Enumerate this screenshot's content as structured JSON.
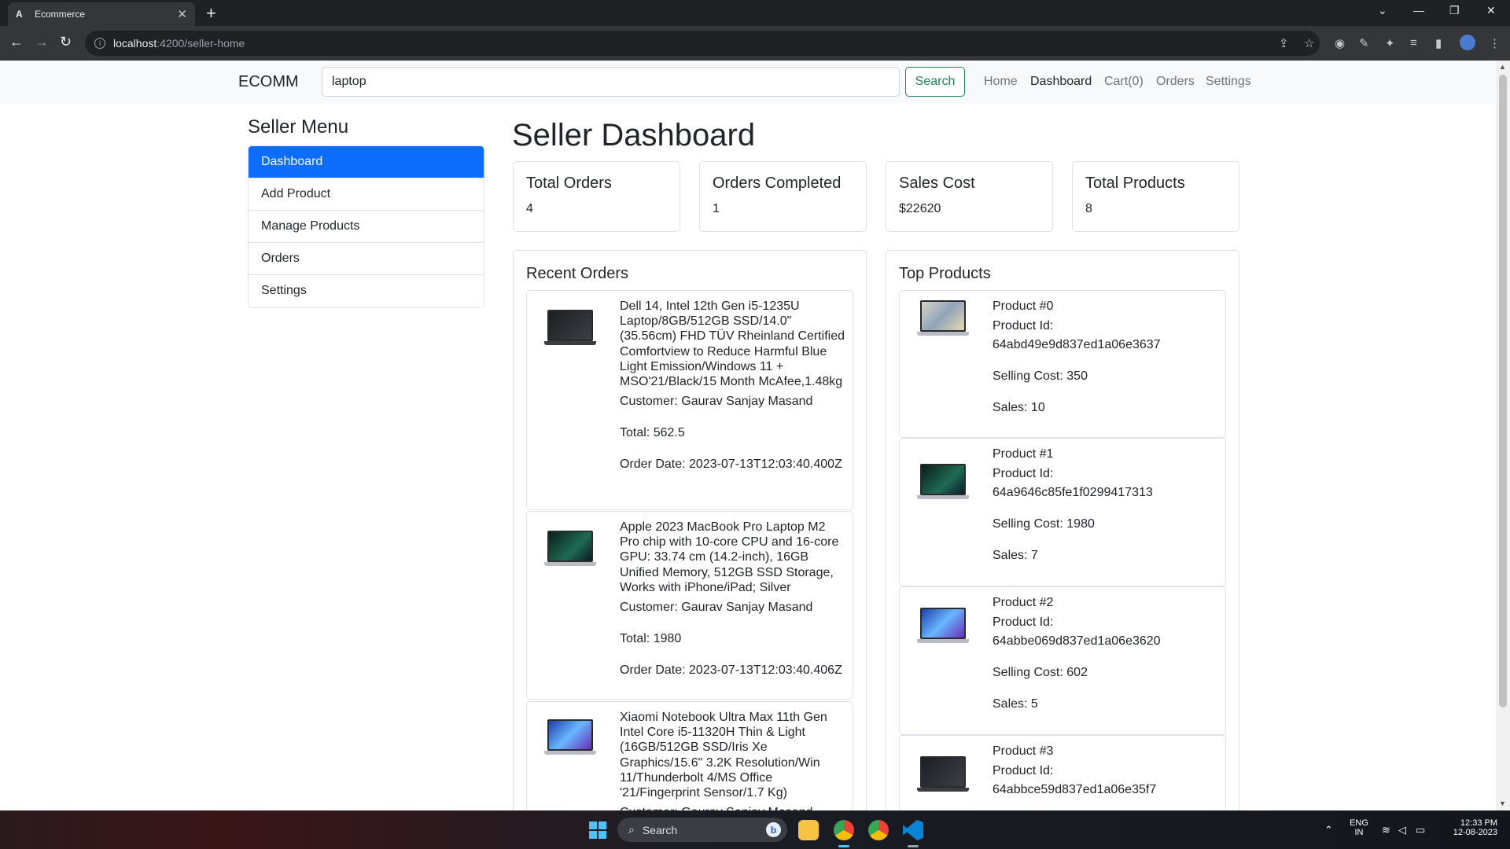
{
  "browser": {
    "tab_title": "Ecommerce",
    "tab_favicon": "A",
    "url_host": "localhost",
    "url_path": ":4200/seller-home"
  },
  "navbar": {
    "brand": "ECOMM",
    "search_value": "laptop",
    "search_button": "Search",
    "links": [
      "Home",
      "Dashboard",
      "Cart(0)",
      "Orders",
      "Settings"
    ],
    "active_link": "Dashboard"
  },
  "sidebar": {
    "title": "Seller Menu",
    "items": [
      "Dashboard",
      "Add Product",
      "Manage Products",
      "Orders",
      "Settings"
    ],
    "active_item": "Dashboard"
  },
  "main": {
    "title": "Seller Dashboard",
    "stats": [
      {
        "label": "Total Orders",
        "value": "4"
      },
      {
        "label": "Orders Completed",
        "value": "1"
      },
      {
        "label": "Sales Cost",
        "value": "$22620"
      },
      {
        "label": "Total Products",
        "value": "8"
      }
    ],
    "recent_orders": {
      "title": "Recent Orders",
      "orders": [
        {
          "product": "Dell 14, Intel 12th Gen i5-1235U Laptop/8GB/512GB SSD/14.0\" (35.56cm) FHD TÜV Rheinland Certified Comfortview to Reduce Harmful Blue Light Emission/Windows 11 + MSO'21/Black/15 Month McAfee,1.48kg",
          "customer": "Customer: Gaurav Sanjay Masand",
          "total": "Total: 562.5",
          "date": "Order Date: 2023-07-13T12:03:40.400Z"
        },
        {
          "product": "Apple 2023 MacBook Pro Laptop M2 Pro chip with 10-core CPU and 16-core GPU: 33.74 cm (14.2-inch), 16GB Unified Memory, 512GB SSD Storage, Works with iPhone/iPad; Silver",
          "customer": "Customer: Gaurav Sanjay Masand",
          "total": "Total: 1980",
          "date": "Order Date: 2023-07-13T12:03:40.406Z"
        },
        {
          "product": "Xiaomi Notebook Ultra Max 11th Gen Intel Core i5-11320H Thin & Light (16GB/512GB SSD/Iris Xe Graphics/15.6\" 3.2K Resolution/Win 11/Thunderbolt 4/MS Office '21/Fingerprint Sensor/1.7 Kg)",
          "customer": "Customer: Gaurav Sanjay Masand"
        }
      ]
    },
    "top_products": {
      "title": "Top Products",
      "products": [
        {
          "name": "Product #0",
          "id_label": "Product Id:",
          "id": "64abd49e9d837ed1a06e3637",
          "cost": "Selling Cost: 350",
          "sales": "Sales: 10"
        },
        {
          "name": "Product #1",
          "id_label": "Product Id:",
          "id": "64a9646c85fe1f0299417313",
          "cost": "Selling Cost: 1980",
          "sales": "Sales: 7"
        },
        {
          "name": "Product #2",
          "id_label": "Product Id:",
          "id": "64abbe069d837ed1a06e3620",
          "cost": "Selling Cost: 602",
          "sales": "Sales: 5"
        },
        {
          "name": "Product #3",
          "id_label": "Product Id:",
          "id": "64abbce59d837ed1a06e35f7"
        }
      ]
    }
  },
  "taskbar": {
    "search_placeholder": "Search",
    "lang_top": "ENG",
    "lang_bottom": "IN",
    "time": "12:33 PM",
    "date": "12-08-2023"
  },
  "colors": {
    "primary": "#0d6efd",
    "success": "#198754",
    "navbar_bg": "#f8f9fa"
  },
  "icons": [
    "search-icon",
    "back-icon",
    "forward-icon",
    "reload-icon",
    "star-icon",
    "extensions-icon",
    "windows-start-icon",
    "file-explorer-icon",
    "chrome-icon",
    "vscode-icon",
    "wifi-icon",
    "volume-icon",
    "battery-icon"
  ]
}
